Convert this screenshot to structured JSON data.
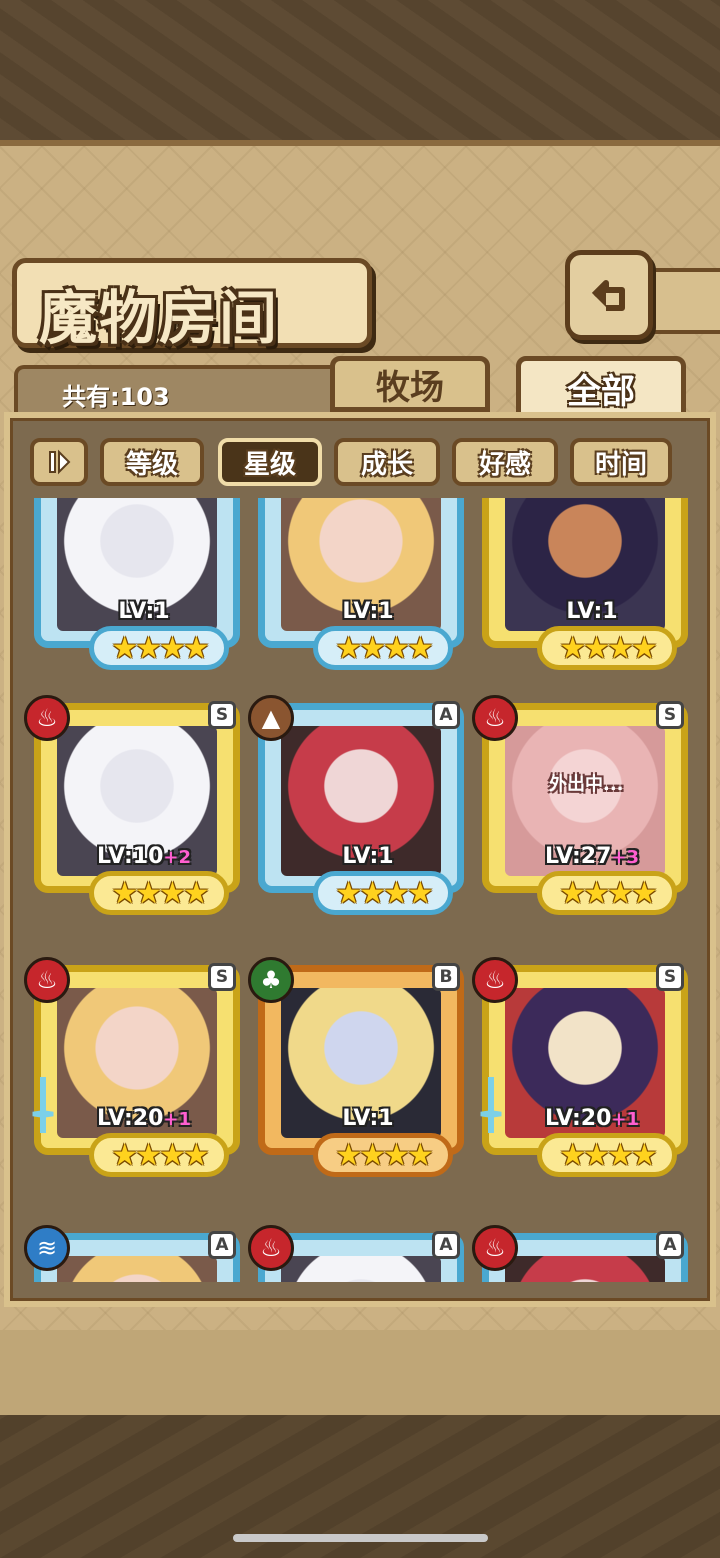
{
  "header": {
    "title": "魔物房间",
    "back_icon": "return-arrow-icon"
  },
  "count": {
    "label": "共有:103"
  },
  "tabs": [
    {
      "label": "牧场",
      "active": false
    },
    {
      "label": "全部",
      "active": true
    }
  ],
  "sort": {
    "toggle_icon": "pause-sort-icon",
    "buttons": [
      {
        "label": "等级",
        "active": false
      },
      {
        "label": "星级",
        "active": true
      },
      {
        "label": "成长",
        "active": false
      },
      {
        "label": "好感",
        "active": false
      },
      {
        "label": "时间",
        "active": false
      }
    ]
  },
  "monsters": [
    {
      "lv": "LV:1",
      "plus": "",
      "stars": "★★★★",
      "frame": "blue",
      "element": "",
      "rank": "",
      "look": "white"
    },
    {
      "lv": "LV:1",
      "plus": "",
      "stars": "★★★★",
      "frame": "blue",
      "element": "",
      "rank": "",
      "look": "blonde"
    },
    {
      "lv": "LV:1",
      "plus": "",
      "stars": "★★★★",
      "frame": "gold",
      "element": "",
      "rank": "",
      "look": "dark"
    },
    {
      "lv": "LV:10",
      "plus": "+2",
      "stars": "★★★★",
      "frame": "gold",
      "element": "fire",
      "rank": "S",
      "look": "white"
    },
    {
      "lv": "LV:1",
      "plus": "",
      "stars": "★★★★",
      "frame": "blue",
      "element": "earth",
      "rank": "A",
      "look": "red"
    },
    {
      "lv": "LV:27",
      "plus": "+3",
      "stars": "★★★★",
      "frame": "gold",
      "element": "fire",
      "rank": "S",
      "look": "pink",
      "status": "外出中..."
    },
    {
      "lv": "LV:20",
      "plus": "+1",
      "stars": "★★★★",
      "frame": "gold",
      "element": "fire",
      "rank": "S",
      "look": "blonde",
      "weapon": true
    },
    {
      "lv": "LV:1",
      "plus": "",
      "stars": "★★★★",
      "frame": "orange",
      "element": "leaf",
      "rank": "B",
      "look": "blondehat"
    },
    {
      "lv": "LV:20",
      "plus": "+1",
      "stars": "★★★★",
      "frame": "gold",
      "element": "fire",
      "rank": "S",
      "look": "purple",
      "weapon": true
    },
    {
      "lv": "",
      "plus": "",
      "stars": "",
      "frame": "blue",
      "element": "water",
      "rank": "A",
      "look": "blonde"
    },
    {
      "lv": "",
      "plus": "",
      "stars": "",
      "frame": "blue",
      "element": "fire",
      "rank": "A",
      "look": "white"
    },
    {
      "lv": "",
      "plus": "",
      "stars": "",
      "frame": "blue",
      "element": "fire",
      "rank": "A",
      "look": "red"
    }
  ],
  "element_glyphs": {
    "fire": "♨",
    "earth": "▲",
    "leaf": "♣",
    "water": "≋"
  }
}
